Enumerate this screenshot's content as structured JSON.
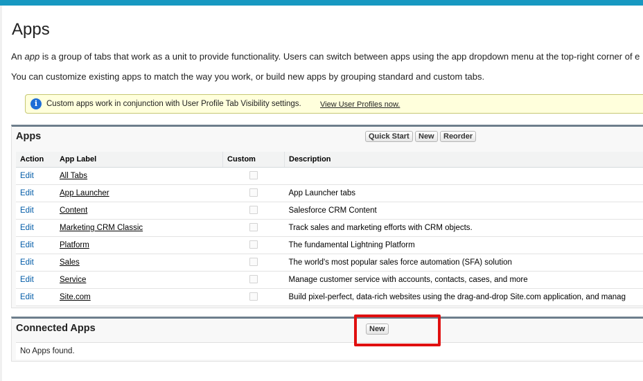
{
  "page": {
    "title": "Apps",
    "intro_prefix": "An ",
    "intro_em": "app",
    "intro_suffix": " is a group of tabs that work as a unit to provide functionality. Users can switch between apps using the app dropdown menu at the top-right corner of e",
    "intro2": "You can customize existing apps to match the way you work, or build new apps by grouping standard and custom tabs."
  },
  "info": {
    "text": "Custom apps work in conjunction with User Profile Tab Visibility settings.",
    "link": "View User Profiles now."
  },
  "apps_section": {
    "title": "Apps",
    "buttons": {
      "quick_start": "Quick Start",
      "new": "New",
      "reorder": "Reorder"
    },
    "columns": {
      "action": "Action",
      "label": "App Label",
      "custom": "Custom",
      "description": "Description"
    },
    "rows": [
      {
        "action": "Edit",
        "label": "All Tabs",
        "custom": false,
        "description": ""
      },
      {
        "action": "Edit",
        "label": "App Launcher",
        "custom": false,
        "description": "App Launcher tabs"
      },
      {
        "action": "Edit",
        "label": "Content",
        "custom": false,
        "description": "Salesforce CRM Content"
      },
      {
        "action": "Edit",
        "label": "Marketing CRM Classic",
        "custom": false,
        "description": "Track sales and marketing efforts with CRM objects."
      },
      {
        "action": "Edit",
        "label": "Platform",
        "custom": false,
        "description": "The fundamental Lightning Platform"
      },
      {
        "action": "Edit",
        "label": "Sales",
        "custom": false,
        "description": "The world's most popular sales force automation (SFA) solution"
      },
      {
        "action": "Edit",
        "label": "Service",
        "custom": false,
        "description": "Manage customer service with accounts, contacts, cases, and more"
      },
      {
        "action": "Edit",
        "label": "Site.com",
        "custom": false,
        "description": "Build pixel-perfect, data-rich websites using the drag-and-drop Site.com application, and manag"
      }
    ]
  },
  "connected_apps": {
    "title": "Connected Apps",
    "new_button": "New",
    "empty_text": "No Apps found."
  },
  "icons": {
    "info": "info-icon",
    "checkbox": "checkbox-icon"
  },
  "colors": {
    "header_bar": "#1798c1",
    "link": "#015ba7",
    "highlight": "#e01010",
    "info_bg": "#ffffdc"
  }
}
